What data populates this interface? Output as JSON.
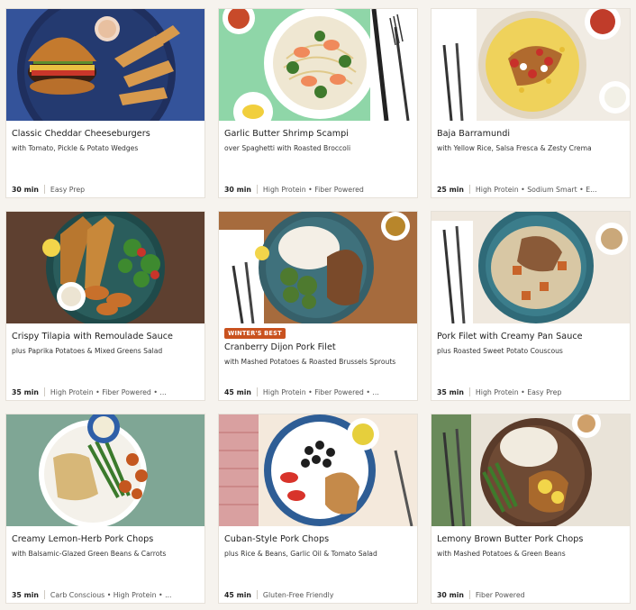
{
  "recipes": [
    {
      "title": "Classic Cheddar Cheeseburgers",
      "subtitle": "with Tomato, Pickle & Potato Wedges",
      "time": "30 min",
      "tags": "Easy Prep",
      "image": "cheeseburger-photo"
    },
    {
      "title": "Garlic Butter Shrimp Scampi",
      "subtitle": "over Spaghetti with Roasted Broccoli",
      "time": "30 min",
      "tags": "High Protein • Fiber Powered",
      "image": "shrimp-scampi-photo"
    },
    {
      "title": "Baja Barramundi",
      "subtitle": "with Yellow Rice, Salsa Fresca & Zesty Crema",
      "time": "25 min",
      "tags": "High Protein • Sodium Smart • E...",
      "image": "barramundi-photo"
    },
    {
      "title": "Crispy Tilapia with Remoulade Sauce",
      "subtitle": "plus Paprika Potatoes & Mixed Greens Salad",
      "time": "35 min",
      "tags": "High Protein • Fiber Powered • ...",
      "image": "tilapia-photo"
    },
    {
      "title": "Cranberry Dijon Pork Filet",
      "subtitle": "with Mashed Potatoes & Roasted Brussels Sprouts",
      "time": "45 min",
      "tags": "High Protein • Fiber Powered • ...",
      "badge": "WINTER'S BEST",
      "image": "pork-filet-photo"
    },
    {
      "title": "Pork Filet with Creamy Pan Sauce",
      "subtitle": "plus Roasted Sweet Potato Couscous",
      "time": "35 min",
      "tags": "High Protein • Easy Prep",
      "image": "pork-couscous-photo"
    },
    {
      "title": "Creamy Lemon-Herb Pork Chops",
      "subtitle": "with Balsamic-Glazed Green Beans & Carrots",
      "time": "35 min",
      "tags": "Carb Conscious • High Protein • ...",
      "image": "lemon-herb-pork-photo"
    },
    {
      "title": "Cuban-Style Pork Chops",
      "subtitle": "plus Rice & Beans, Garlic Oil & Tomato Salad",
      "time": "45 min",
      "tags": "Gluten-Free Friendly",
      "image": "cuban-pork-photo"
    },
    {
      "title": "Lemony Brown Butter Pork Chops",
      "subtitle": "with Mashed Potatoes & Green Beans",
      "time": "30 min",
      "tags": "Fiber Powered",
      "image": "brown-butter-pork-photo"
    }
  ],
  "colors": {
    "badge": "#c9521f",
    "card_bg": "#ffffff",
    "page_bg": "#f6f3ee"
  }
}
